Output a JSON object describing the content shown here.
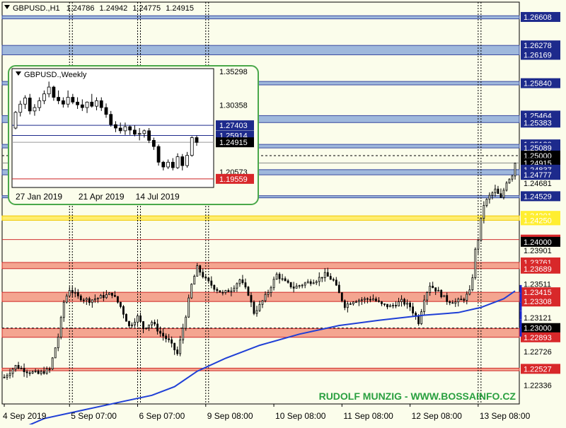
{
  "header": {
    "symbol": "GBPUSD.,H1",
    "open": "1.24786",
    "high": "1.24942",
    "low": "1.24775",
    "close": "1.24915"
  },
  "watermark": "RUDOLF MUNZIG - WWW.BOSSAINFO.CZ",
  "colors": {
    "background": "#fbfdeb",
    "bull_candle": "#fbfdeb",
    "bear_candle": "#000000",
    "moving_average": "#1f3fd6",
    "resistance_zone": "#9fb8dc",
    "support_zone": "#f4a590",
    "yellow_zone": "#ffee70",
    "current_price_label": "#000000",
    "inset_border": "#4aa84a",
    "watermark_text": "#2aa040"
  },
  "chart_data": [
    {
      "type": "candlestick",
      "title": "GBPUSD.,H1",
      "x_ticks": [
        "4 Sep 2019",
        "5 Sep 07:00",
        "6 Sep 07:00",
        "9 Sep 08:00",
        "10 Sep 08:00",
        "11 Sep 08:00",
        "12 Sep 08:00",
        "13 Sep 08:00"
      ],
      "y_ticks": [
        "1.26608",
        "1.26278",
        "1.26169",
        "1.25840",
        "1.25464",
        "1.25383",
        "1.25130",
        "1.25089",
        "1.25000",
        "1.24915",
        "1.24837",
        "1.24777",
        "1.24681",
        "1.24529",
        "1.24301",
        "1.24250",
        "1.24026",
        "1.24000",
        "1.23901",
        "1.23761",
        "1.23689",
        "1.23511",
        "1.23415",
        "1.23308",
        "1.23121",
        "1.23000",
        "1.22893",
        "1.22726",
        "1.22527",
        "1.22336"
      ],
      "y_range": [
        1.2212,
        1.2678
      ],
      "current_price": 1.24915,
      "price_labels": [
        {
          "value": 1.26608,
          "text": "1.26608",
          "style": "blue"
        },
        {
          "value": 1.26278,
          "text": "1.26278",
          "style": "blue"
        },
        {
          "value": 1.26169,
          "text": "1.26169",
          "style": "blue"
        },
        {
          "value": 1.2584,
          "text": "1.25840",
          "style": "blue"
        },
        {
          "value": 1.25464,
          "text": "1.25464",
          "style": "blue"
        },
        {
          "value": 1.25383,
          "text": "1.25383",
          "style": "blue"
        },
        {
          "value": 1.2513,
          "text": "1.25130",
          "style": "blue"
        },
        {
          "value": 1.25089,
          "text": "1.25089",
          "style": "blue"
        },
        {
          "value": 1.25,
          "text": "1.25000",
          "style": "black"
        },
        {
          "value": 1.24915,
          "text": "1.24915",
          "style": "black"
        },
        {
          "value": 1.24837,
          "text": "1.24837",
          "style": "blue"
        },
        {
          "value": 1.24777,
          "text": "1.24777",
          "style": "blue"
        },
        {
          "value": 1.24681,
          "text": "1.24681",
          "style": "plain"
        },
        {
          "value": 1.24529,
          "text": "1.24529",
          "style": "blue"
        },
        {
          "value": 1.24301,
          "text": "1.24301",
          "style": "yellow"
        },
        {
          "value": 1.2425,
          "text": "1.24250",
          "style": "yellow"
        },
        {
          "value": 1.24026,
          "text": "1.24026",
          "style": "red"
        },
        {
          "value": 1.24,
          "text": "1.24000",
          "style": "black"
        },
        {
          "value": 1.23901,
          "text": "1.23901",
          "style": "plain"
        },
        {
          "value": 1.23761,
          "text": "1.23761",
          "style": "red"
        },
        {
          "value": 1.23689,
          "text": "1.23689",
          "style": "red"
        },
        {
          "value": 1.23511,
          "text": "1.23511",
          "style": "plain"
        },
        {
          "value": 1.23415,
          "text": "1.23415",
          "style": "red"
        },
        {
          "value": 1.23308,
          "text": "1.23308",
          "style": "red"
        },
        {
          "value": 1.23121,
          "text": "1.23121",
          "style": "plain"
        },
        {
          "value": 1.23,
          "text": "1.23000",
          "style": "black"
        },
        {
          "value": 1.22893,
          "text": "1.22893",
          "style": "red"
        },
        {
          "value": 1.22726,
          "text": "1.22726",
          "style": "plain"
        },
        {
          "value": 1.22527,
          "text": "1.22527",
          "style": "red"
        },
        {
          "value": 1.22336,
          "text": "1.22336",
          "style": "plain"
        }
      ],
      "zones": [
        {
          "kind": "resistance",
          "from": 1.26586,
          "to": 1.26622
        },
        {
          "kind": "resistance",
          "from": 1.26169,
          "to": 1.26278
        },
        {
          "kind": "resistance",
          "from": 1.2582,
          "to": 1.2586
        },
        {
          "kind": "resistance",
          "from": 1.25383,
          "to": 1.25464
        },
        {
          "kind": "resistance",
          "from": 1.25089,
          "to": 1.2513
        },
        {
          "kind": "resistance",
          "from": 1.24777,
          "to": 1.24837
        },
        {
          "kind": "resistance",
          "from": 1.24515,
          "to": 1.24535
        },
        {
          "kind": "yellow",
          "from": 1.2425,
          "to": 1.24301
        },
        {
          "kind": "support",
          "from": 1.23689,
          "to": 1.23761
        },
        {
          "kind": "support",
          "from": 1.23308,
          "to": 1.23415
        },
        {
          "kind": "support",
          "from": 1.22893,
          "to": 1.22995
        },
        {
          "kind": "support",
          "from": 1.22505,
          "to": 1.22535
        }
      ],
      "levels": [
        {
          "value": 1.24026,
          "color": "#d03030"
        },
        {
          "value": 1.25,
          "color": "#000000",
          "dashed": true
        },
        {
          "value": 1.23,
          "color": "#000000",
          "dashed": true
        }
      ],
      "day_separators": [
        "5 Sep 07:00",
        "6 Sep 07:00",
        "9 Sep 08:00",
        "13 Sep 08:00"
      ],
      "moving_average": [
        [
          0,
          1.2175
        ],
        [
          14,
          1.2195
        ],
        [
          28,
          1.2205
        ],
        [
          42,
          1.2215
        ],
        [
          52,
          1.2222
        ],
        [
          60,
          1.2232
        ],
        [
          68,
          1.225
        ],
        [
          78,
          1.2265
        ],
        [
          90,
          1.228
        ],
        [
          104,
          1.2293
        ],
        [
          118,
          1.2303
        ],
        [
          132,
          1.2309
        ],
        [
          148,
          1.2315
        ],
        [
          160,
          1.2318
        ],
        [
          168,
          1.2324
        ],
        [
          176,
          1.2334
        ],
        [
          180,
          1.2343
        ]
      ],
      "price_path": [
        [
          0,
          1.2243
        ],
        [
          4,
          1.2256
        ],
        [
          8,
          1.225
        ],
        [
          12,
          1.2247
        ],
        [
          16,
          1.2252
        ],
        [
          19,
          1.229
        ],
        [
          21,
          1.233
        ],
        [
          23,
          1.2345
        ],
        [
          26,
          1.2336
        ],
        [
          30,
          1.2332
        ],
        [
          34,
          1.2336
        ],
        [
          38,
          1.234
        ],
        [
          41,
          1.2325
        ],
        [
          44,
          1.2302
        ],
        [
          47,
          1.2313
        ],
        [
          49,
          1.23
        ],
        [
          52,
          1.2307
        ],
        [
          55,
          1.2294
        ],
        [
          58,
          1.2285
        ],
        [
          61,
          1.227
        ],
        [
          64,
          1.2315
        ],
        [
          66,
          1.235
        ],
        [
          68,
          1.237
        ],
        [
          71,
          1.2356
        ],
        [
          74,
          1.2347
        ],
        [
          77,
          1.234
        ],
        [
          80,
          1.2345
        ],
        [
          83,
          1.2356
        ],
        [
          86,
          1.234
        ],
        [
          88,
          1.2318
        ],
        [
          90,
          1.2326
        ],
        [
          93,
          1.2342
        ],
        [
          96,
          1.2362
        ],
        [
          99,
          1.2353
        ],
        [
          102,
          1.2347
        ],
        [
          106,
          1.2352
        ],
        [
          110,
          1.2356
        ],
        [
          113,
          1.2362
        ],
        [
          116,
          1.2355
        ],
        [
          118,
          1.234
        ],
        [
          120,
          1.2326
        ],
        [
          123,
          1.2332
        ],
        [
          126,
          1.2333
        ],
        [
          130,
          1.2334
        ],
        [
          133,
          1.2327
        ],
        [
          136,
          1.2325
        ],
        [
          140,
          1.2331
        ],
        [
          143,
          1.2325
        ],
        [
          146,
          1.2307
        ],
        [
          148,
          1.2335
        ],
        [
          150,
          1.235
        ],
        [
          153,
          1.2342
        ],
        [
          156,
          1.2332
        ],
        [
          159,
          1.233
        ],
        [
          162,
          1.2334
        ],
        [
          164,
          1.2342
        ],
        [
          165,
          1.236
        ],
        [
          166,
          1.239
        ],
        [
          167,
          1.2403
        ],
        [
          168,
          1.2425
        ],
        [
          169,
          1.2443
        ],
        [
          171,
          1.2453
        ],
        [
          173,
          1.246
        ],
        [
          175,
          1.245
        ],
        [
          177,
          1.247
        ],
        [
          179,
          1.2478
        ],
        [
          180,
          1.2492
        ]
      ]
    },
    {
      "type": "candlestick",
      "title": "GBPUSD.,Weekly",
      "x_ticks": [
        "27 Jan 2019",
        "21 Apr 2019",
        "14 Jul 2019"
      ],
      "y_ticks": [
        "1.35298",
        "1.30358",
        "1.27403",
        "1.25914",
        "1.24915",
        "1.20573",
        "1.19559"
      ],
      "y_range": [
        1.183,
        1.357
      ],
      "levels": [
        {
          "value": 1.27403,
          "color": "#1d2a8c"
        },
        {
          "value": 1.25914,
          "color": "#1d2a8c"
        },
        {
          "value": 1.19559,
          "color": "#cc2222"
        },
        {
          "value": 1.24915,
          "color": "#999999"
        }
      ],
      "price_labels": [
        {
          "value": 1.27403,
          "text": "1.27403",
          "style": "darkblue"
        },
        {
          "value": 1.25914,
          "text": "1.25914",
          "style": "darkblue"
        },
        {
          "value": 1.24915,
          "text": "1.24915",
          "style": "black"
        },
        {
          "value": 1.19559,
          "text": "1.19559",
          "style": "red"
        }
      ],
      "candles": [
        [
          1.27,
          1.295,
          1.268,
          1.293
        ],
        [
          1.293,
          1.31,
          1.287,
          1.305
        ],
        [
          1.305,
          1.318,
          1.298,
          1.314
        ],
        [
          1.314,
          1.32,
          1.29,
          1.295
        ],
        [
          1.295,
          1.305,
          1.288,
          1.3
        ],
        [
          1.3,
          1.315,
          1.295,
          1.31
        ],
        [
          1.31,
          1.325,
          1.305,
          1.32
        ],
        [
          1.32,
          1.338,
          1.315,
          1.33
        ],
        [
          1.33,
          1.332,
          1.31,
          1.315
        ],
        [
          1.315,
          1.325,
          1.305,
          1.31
        ],
        [
          1.31,
          1.315,
          1.3,
          1.305
        ],
        [
          1.305,
          1.325,
          1.3,
          1.315
        ],
        [
          1.315,
          1.32,
          1.305,
          1.308
        ],
        [
          1.308,
          1.315,
          1.298,
          1.304
        ],
        [
          1.304,
          1.312,
          1.295,
          1.3
        ],
        [
          1.3,
          1.309,
          1.292,
          1.308
        ],
        [
          1.308,
          1.32,
          1.3,
          1.302
        ],
        [
          1.302,
          1.315,
          1.296,
          1.31
        ],
        [
          1.31,
          1.315,
          1.295,
          1.3
        ],
        [
          1.3,
          1.306,
          1.285,
          1.29
        ],
        [
          1.29,
          1.295,
          1.272,
          1.275
        ],
        [
          1.275,
          1.28,
          1.264,
          1.27
        ],
        [
          1.27,
          1.278,
          1.262,
          1.266
        ],
        [
          1.266,
          1.278,
          1.26,
          1.272
        ],
        [
          1.272,
          1.274,
          1.26,
          1.267
        ],
        [
          1.267,
          1.274,
          1.258,
          1.261
        ],
        [
          1.261,
          1.27,
          1.252,
          1.262
        ],
        [
          1.262,
          1.268,
          1.256,
          1.266
        ],
        [
          1.266,
          1.27,
          1.248,
          1.252
        ],
        [
          1.252,
          1.256,
          1.238,
          1.243
        ],
        [
          1.243,
          1.246,
          1.215,
          1.22
        ],
        [
          1.22,
          1.222,
          1.208,
          1.213
        ],
        [
          1.213,
          1.224,
          1.21,
          1.22
        ],
        [
          1.22,
          1.226,
          1.208,
          1.212
        ],
        [
          1.212,
          1.233,
          1.21,
          1.228
        ],
        [
          1.228,
          1.232,
          1.208,
          1.215
        ],
        [
          1.215,
          1.235,
          1.212,
          1.23
        ],
        [
          1.23,
          1.258,
          1.228,
          1.256
        ],
        [
          1.256,
          1.259,
          1.244,
          1.249
        ]
      ]
    }
  ]
}
